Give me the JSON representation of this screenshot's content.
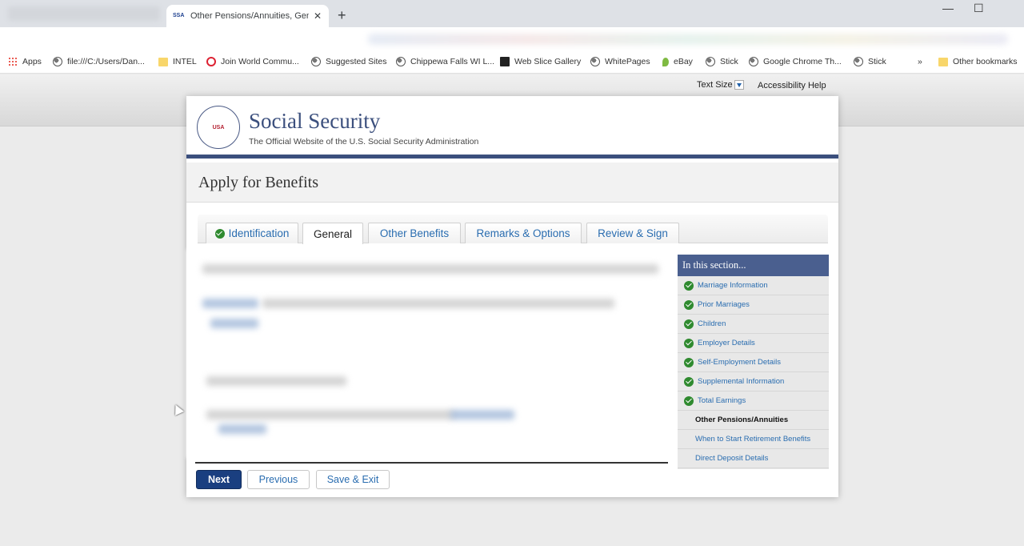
{
  "browser": {
    "tab_title": "Other Pensions/Annuities, Gener",
    "tab_favicon": "SSA",
    "new_tab_glyph": "+",
    "close_glyph": "✕",
    "minimize_glyph": "—",
    "maximize_glyph": "☐",
    "bookmarks": [
      {
        "label": "Apps",
        "icon": "apps-icon"
      },
      {
        "label": "file:///C:/Users/Dan...",
        "icon": "globe-icon"
      },
      {
        "label": "INTEL",
        "icon": "folder-icon"
      },
      {
        "label": "Join World Commu...",
        "icon": "world-icon"
      },
      {
        "label": "Suggested Sites",
        "icon": "globe-icon"
      },
      {
        "label": "Chippewa Falls WI L...",
        "icon": "globe-icon"
      },
      {
        "label": "Web Slice Gallery",
        "icon": "web-slice-icon"
      },
      {
        "label": "WhitePages",
        "icon": "globe-icon"
      },
      {
        "label": "eBay",
        "icon": "ebay-icon"
      },
      {
        "label": "Stick",
        "icon": "globe-icon"
      },
      {
        "label": "Google Chrome Th...",
        "icon": "globe-icon"
      },
      {
        "label": "Stick",
        "icon": "globe-icon"
      }
    ],
    "bookmarks_overflow": "»",
    "other_bookmarks": "Other bookmarks"
  },
  "utility": {
    "text_size": "Text Size",
    "accessibility_help": "Accessibility Help"
  },
  "ssa": {
    "seal_text": "USA",
    "title": "Social Security",
    "subtitle": "The Official Website of the U.S. Social Security Administration"
  },
  "page": {
    "heading": "Apply for Benefits",
    "tabs": [
      {
        "label": "Identification",
        "completed": true,
        "active": false
      },
      {
        "label": "General",
        "completed": false,
        "active": true
      },
      {
        "label": "Other Benefits",
        "completed": false,
        "active": false
      },
      {
        "label": "Remarks & Options",
        "completed": false,
        "active": false
      },
      {
        "label": "Review & Sign",
        "completed": false,
        "active": false
      }
    ],
    "buttons": {
      "next": "Next",
      "previous": "Previous",
      "save_exit": "Save & Exit"
    }
  },
  "section_nav": {
    "heading": "In this section...",
    "items": [
      {
        "label": "Marriage Information",
        "completed": true
      },
      {
        "label": "Prior Marriages",
        "completed": true
      },
      {
        "label": "Children",
        "completed": true
      },
      {
        "label": "Employer Details",
        "completed": true
      },
      {
        "label": "Self-Employment Details",
        "completed": true
      },
      {
        "label": "Supplemental Information",
        "completed": true
      },
      {
        "label": "Total Earnings",
        "completed": true
      },
      {
        "label": "Other Pensions/Annuities",
        "completed": false,
        "current": true
      },
      {
        "label": "When to Start Retirement Benefits",
        "completed": false
      },
      {
        "label": "Direct Deposit Details",
        "completed": false
      }
    ]
  },
  "colors": {
    "ssa_blue": "#3b4f7d",
    "link_blue": "#2a6db0",
    "check_green": "#2f8a2f",
    "primary_button": "#1a3f80"
  }
}
